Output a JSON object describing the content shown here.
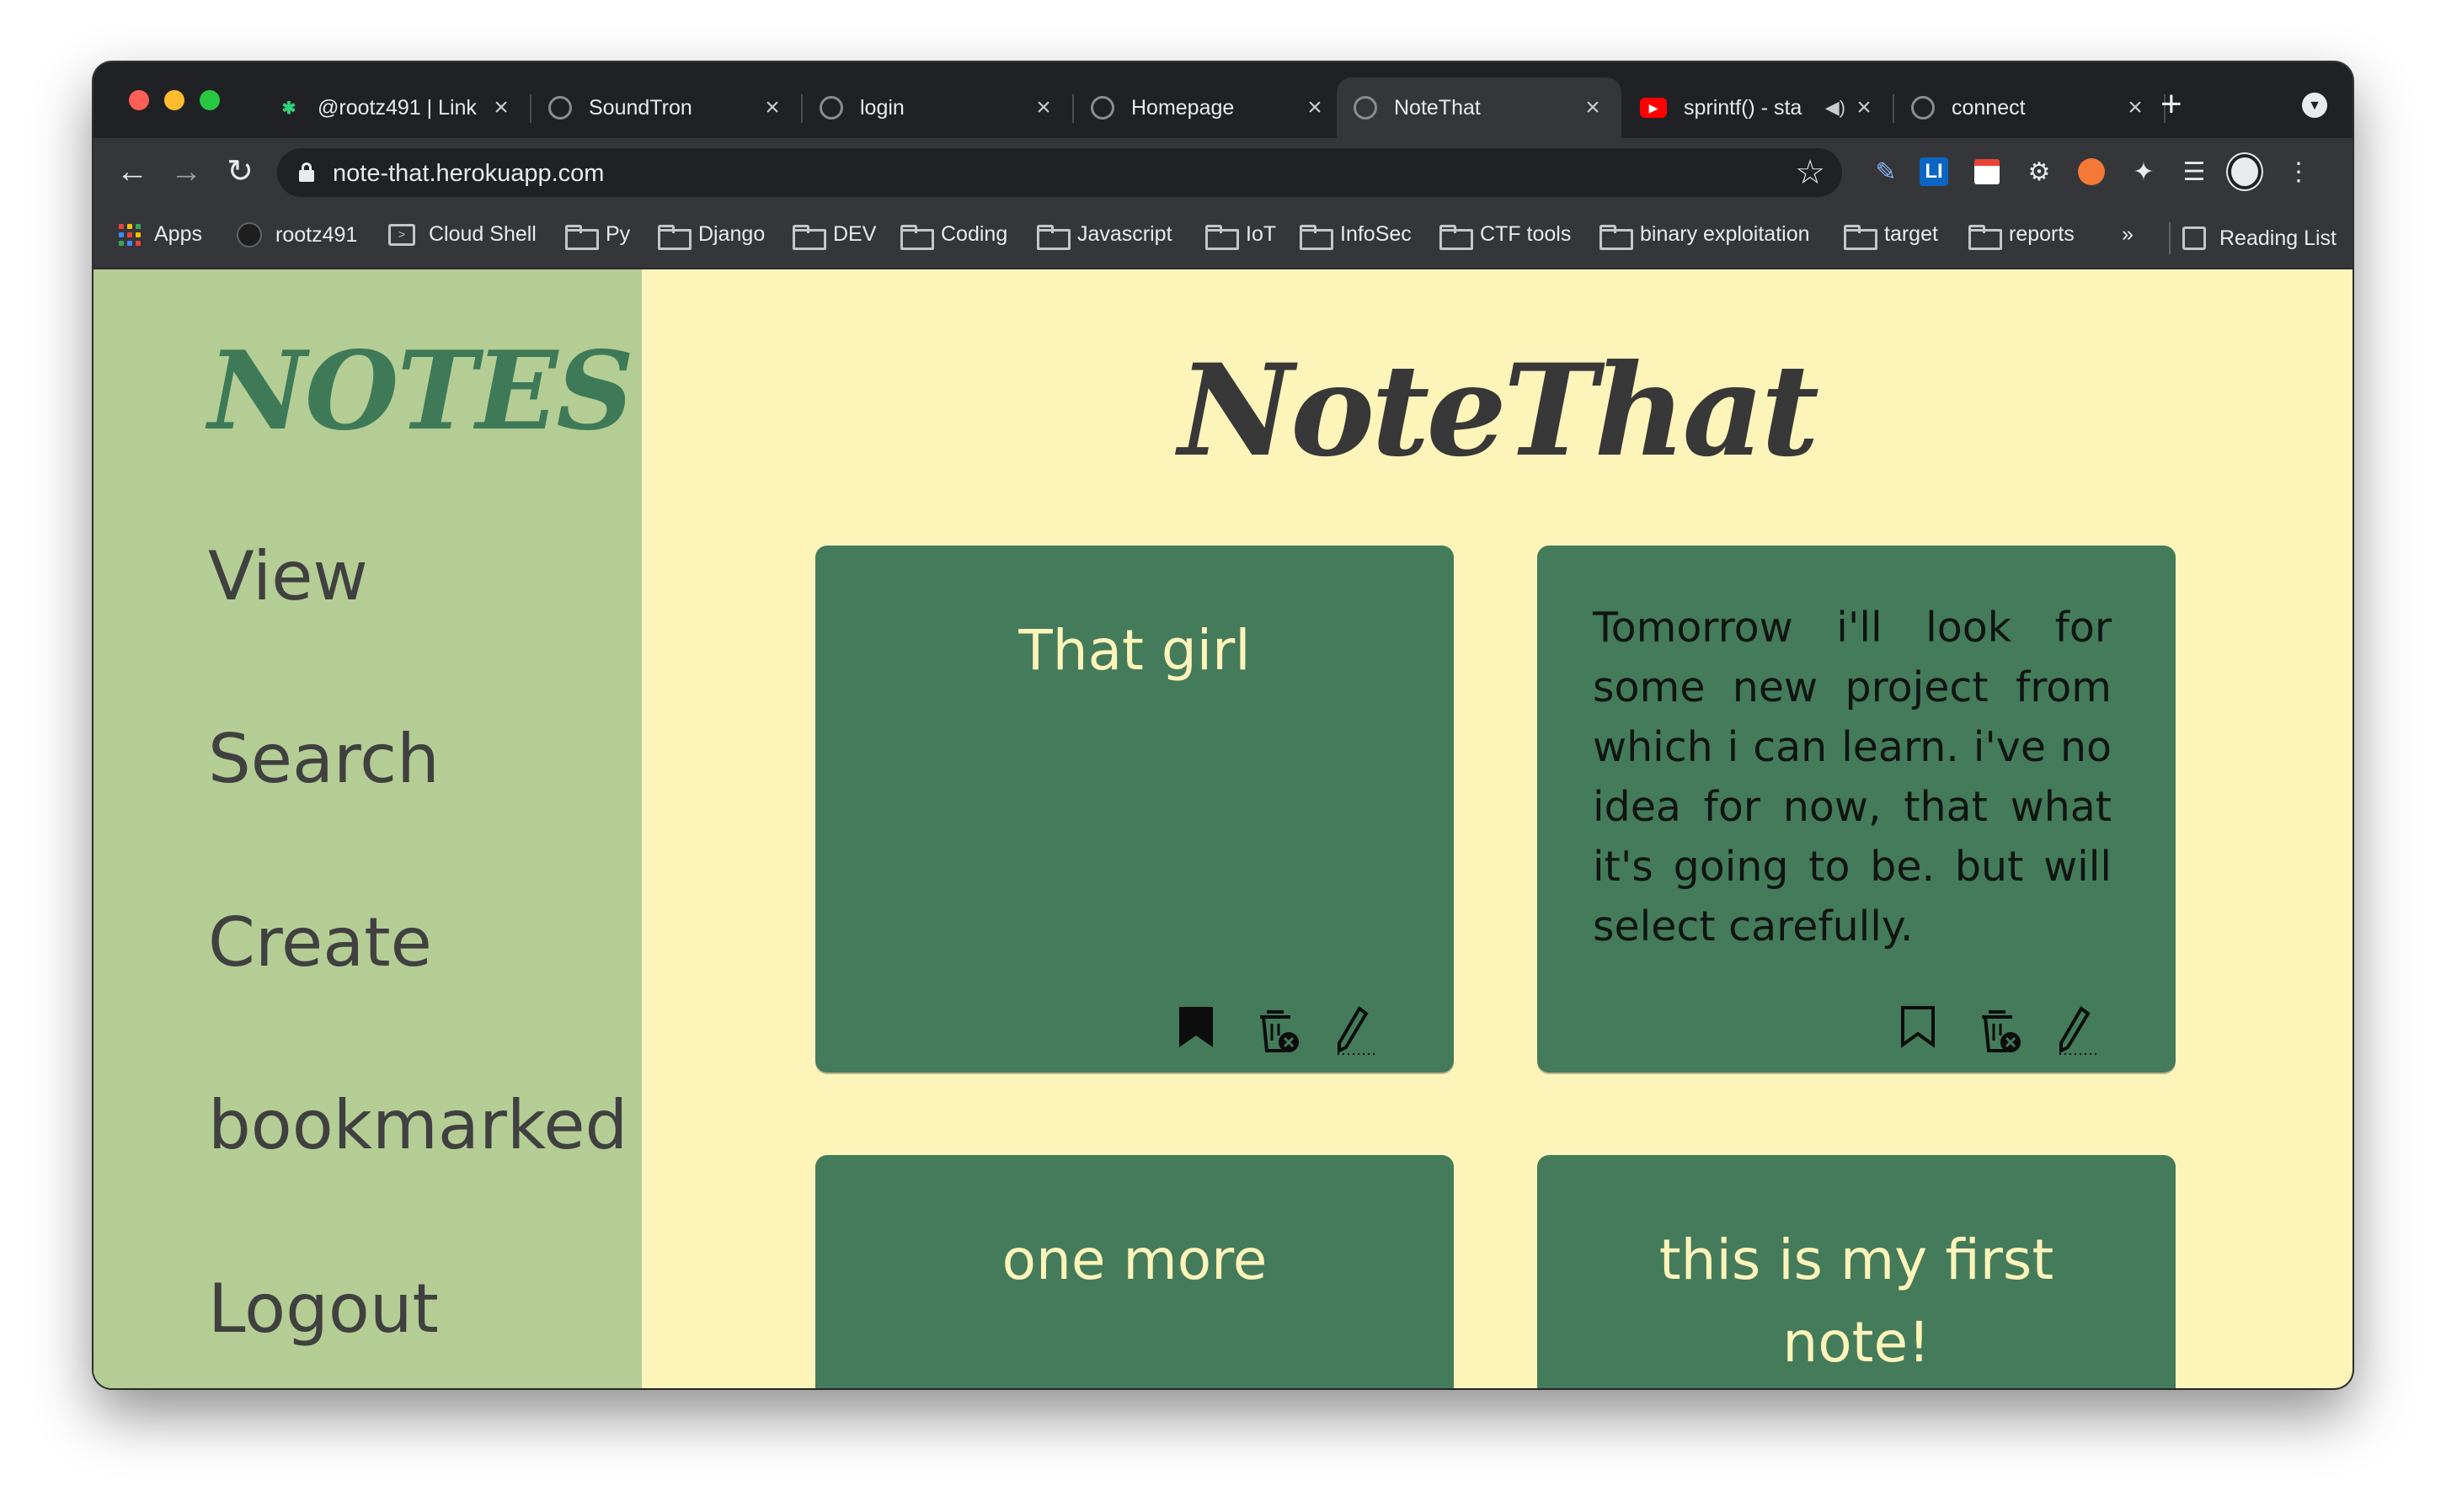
{
  "browser": {
    "tabs": [
      {
        "title": "@rootz491 | Link",
        "favicon": "linktree-icon",
        "active": false
      },
      {
        "title": "SoundTron",
        "favicon": "globe-icon",
        "active": false
      },
      {
        "title": "login",
        "favicon": "globe-icon",
        "active": false
      },
      {
        "title": "Homepage",
        "favicon": "globe-icon",
        "active": false
      },
      {
        "title": "NoteThat",
        "favicon": "globe-icon",
        "active": true
      },
      {
        "title": "sprintf() - sta",
        "favicon": "youtube-icon",
        "active": false,
        "audio": true
      },
      {
        "title": "connect",
        "favicon": "globe-icon",
        "active": false
      }
    ],
    "url": "note-that.herokuapp.com",
    "bookmarks": [
      {
        "label": "Apps",
        "icon": "apps-grid-icon"
      },
      {
        "label": "rootz491",
        "icon": "github-icon"
      },
      {
        "label": "Cloud Shell",
        "icon": "cloud-shell-icon"
      },
      {
        "label": "Py",
        "icon": "folder-icon"
      },
      {
        "label": "Django",
        "icon": "folder-icon"
      },
      {
        "label": "DEV",
        "icon": "folder-icon"
      },
      {
        "label": "Coding",
        "icon": "folder-icon"
      },
      {
        "label": "Javascript",
        "icon": "folder-icon"
      },
      {
        "label": "IoT",
        "icon": "folder-icon"
      },
      {
        "label": "InfoSec",
        "icon": "folder-icon"
      },
      {
        "label": "CTF tools",
        "icon": "folder-icon"
      },
      {
        "label": "binary exploitation",
        "icon": "folder-icon"
      },
      {
        "label": "target",
        "icon": "folder-icon"
      },
      {
        "label": "reports",
        "icon": "folder-icon"
      }
    ],
    "overflow": "»",
    "reading_list": "Reading List"
  },
  "sidebar": {
    "logo": "NOTES",
    "items": [
      {
        "label": "View"
      },
      {
        "label": "Search"
      },
      {
        "label": "Create"
      },
      {
        "label": "bookmarked"
      },
      {
        "label": "Logout"
      }
    ]
  },
  "main": {
    "brand": "NoteThat",
    "notes": [
      {
        "text": "That girl",
        "bookmarked": true
      },
      {
        "text": "Tomorrow i'll look for some new project from which i can learn. i've no idea for now, that what it's going to be. but will select carefully.",
        "bookmarked": false
      },
      {
        "text": "one more"
      },
      {
        "text": "this is my first note!"
      }
    ]
  },
  "colors": {
    "sidebar_bg": "#b4cd94",
    "page_bg": "#fdf4ba",
    "card_bg": "#447b5b",
    "logo": "#3f7a58",
    "card_title": "#fdf4ba",
    "brand_text": "#383838"
  }
}
